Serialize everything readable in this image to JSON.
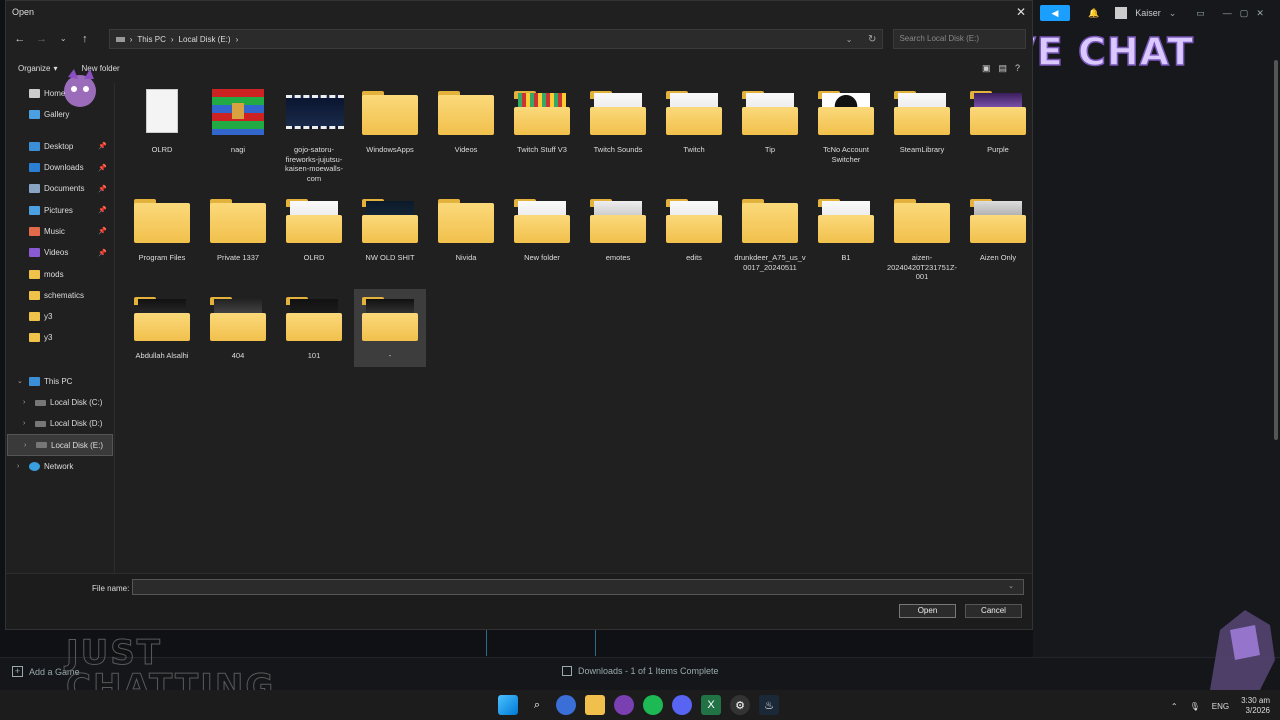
{
  "dialog": {
    "title": "Open",
    "breadcrumb": [
      "This PC",
      "Local Disk (E:)"
    ],
    "search_placeholder": "Search Local Disk (E:)",
    "toolbar": {
      "organize_label": "Organize",
      "new_folder_label": "New folder"
    },
    "file_name_label": "File name:",
    "file_name_value": "",
    "open_label": "Open",
    "cancel_label": "Cancel"
  },
  "sidebar": {
    "items": [
      {
        "label": "Home",
        "icon": "home-icon",
        "pinned": false
      },
      {
        "label": "Gallery",
        "icon": "gallery-icon",
        "pinned": false
      },
      {
        "label": "Desktop",
        "icon": "desktop-icon",
        "pinned": true
      },
      {
        "label": "Downloads",
        "icon": "downloads-icon",
        "pinned": true
      },
      {
        "label": "Documents",
        "icon": "documents-icon",
        "pinned": true
      },
      {
        "label": "Pictures",
        "icon": "pictures-icon",
        "pinned": true
      },
      {
        "label": "Music",
        "icon": "music-icon",
        "pinned": true
      },
      {
        "label": "Videos",
        "icon": "videos-icon",
        "pinned": true
      },
      {
        "label": "mods",
        "icon": "folder-icon",
        "pinned": false
      },
      {
        "label": "schematics",
        "icon": "folder-icon",
        "pinned": false
      },
      {
        "label": "y3",
        "icon": "folder-icon",
        "pinned": false
      },
      {
        "label": "y3",
        "icon": "folder-icon",
        "pinned": false
      }
    ],
    "tree": [
      {
        "label": "This PC",
        "icon": "pc-icon"
      },
      {
        "label": "Local Disk (C:)",
        "icon": "disk-icon"
      },
      {
        "label": "Local Disk (D:)",
        "icon": "disk-icon"
      },
      {
        "label": "Local Disk (E:)",
        "icon": "disk-icon",
        "selected": true
      },
      {
        "label": "Network",
        "icon": "network-icon"
      }
    ]
  },
  "files": [
    {
      "name": "OLRD",
      "kind": "document"
    },
    {
      "name": "nagi",
      "kind": "archive"
    },
    {
      "name": "gojo-satoru-fireworks-jujutsu-kaisen-moewalls-com",
      "kind": "video"
    },
    {
      "name": "WindowsApps",
      "kind": "folder"
    },
    {
      "name": "Videos",
      "kind": "folder"
    },
    {
      "name": "Twitch Stuff V3",
      "kind": "folder-preview"
    },
    {
      "name": "Twitch Sounds",
      "kind": "folder-preview"
    },
    {
      "name": "Twitch",
      "kind": "folder-preview"
    },
    {
      "name": "Tip",
      "kind": "folder-preview"
    },
    {
      "name": "TcNo Account Switcher",
      "kind": "folder-preview"
    },
    {
      "name": "SteamLibrary",
      "kind": "folder-preview"
    },
    {
      "name": "Purple",
      "kind": "folder-preview"
    },
    {
      "name": "Program Files",
      "kind": "folder"
    },
    {
      "name": "Private 1337",
      "kind": "folder"
    },
    {
      "name": "OLRD",
      "kind": "folder-preview"
    },
    {
      "name": "NW OLD SHIT",
      "kind": "folder-preview"
    },
    {
      "name": "Nivida",
      "kind": "folder"
    },
    {
      "name": "New folder",
      "kind": "folder-preview"
    },
    {
      "name": "emotes",
      "kind": "folder-preview"
    },
    {
      "name": "edits",
      "kind": "folder-preview"
    },
    {
      "name": "drunkdeer_A75_us_v0017_20240511",
      "kind": "folder"
    },
    {
      "name": "B1",
      "kind": "folder-preview"
    },
    {
      "name": "aizen-20240420T231751Z-001",
      "kind": "folder"
    },
    {
      "name": "Aizen Only",
      "kind": "folder-preview"
    },
    {
      "name": "Abdullah Alsalhi",
      "kind": "folder-preview"
    },
    {
      "name": "404",
      "kind": "folder-preview"
    },
    {
      "name": "101",
      "kind": "folder-preview"
    },
    {
      "name": "-",
      "kind": "folder-preview",
      "selected": true
    }
  ],
  "background": {
    "user_name": "Kaiser",
    "live_chat_text": "LIVE CHAT",
    "just_chatting_text": "JUST CHATTING",
    "add_game_label": "Add a Game",
    "downloads_status": "Downloads - 1 of 1 Items Complete"
  },
  "taskbar": {
    "language": "ENG",
    "time": "3:30 am",
    "date": "3/2026"
  },
  "colors": {
    "accent": "#1a9fff",
    "folder": "#f1c04c",
    "dialog_bg": "#202020"
  }
}
